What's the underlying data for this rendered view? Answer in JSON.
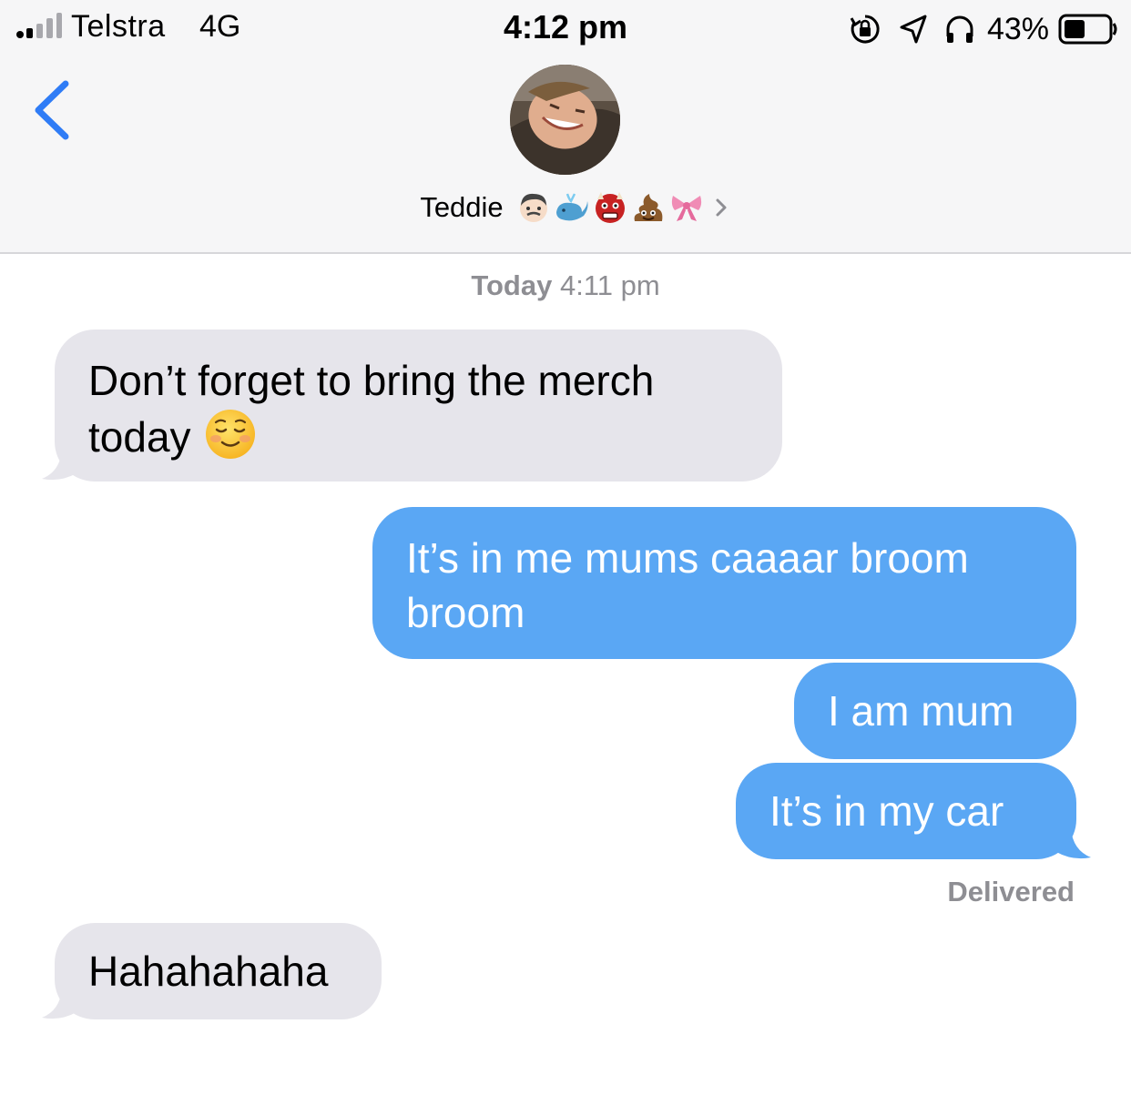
{
  "status_bar": {
    "carrier": "Telstra",
    "network": "4G",
    "time": "4:12 pm",
    "battery_percent": "43%",
    "icons": [
      "signal-icon",
      "rotation-lock-icon",
      "location-arrow-icon",
      "headphones-icon",
      "battery-icon"
    ]
  },
  "header": {
    "contact_name": "Teddie",
    "name_emojis": [
      "man-emoji",
      "whale-emoji",
      "ogre-emoji",
      "poop-emoji",
      "ribbon-emoji"
    ],
    "back_icon": "chevron-left-icon",
    "disclosure_icon": "chevron-right-icon"
  },
  "conversation": {
    "timestamp_day": "Today",
    "timestamp_time": "4:11 pm",
    "messages": [
      {
        "direction": "incoming",
        "text_line1": "Don’t forget to bring the merch",
        "text_line2": "today",
        "emoji": "relieved-smiling-face-emoji"
      },
      {
        "direction": "outgoing",
        "text_line1": "It’s in me mums caaaar broom",
        "text_line2": "broom"
      },
      {
        "direction": "outgoing",
        "text": "I am mum"
      },
      {
        "direction": "outgoing",
        "text": "It’s in my car"
      },
      {
        "direction": "incoming",
        "text": "Hahahahaha"
      }
    ],
    "delivery_status": "Delivered"
  },
  "colors": {
    "incoming_bubble": "#e6e5eb",
    "outgoing_bubble": "#5aa7f4",
    "accent_blue": "#2f7cf6",
    "meta_gray": "#8e8e93"
  }
}
